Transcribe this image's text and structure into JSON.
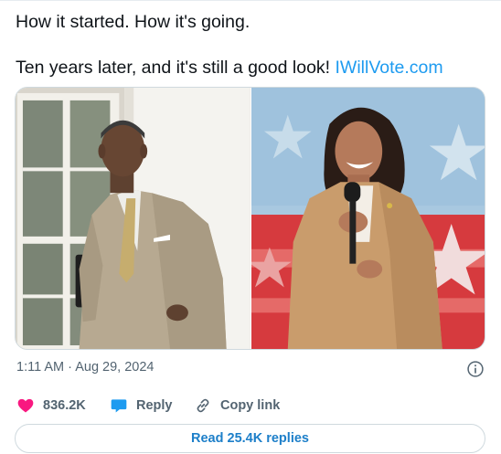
{
  "tweet": {
    "line1": "How it started. How it's going.",
    "line2": "Ten years later, and it's still a good look!",
    "link_text": "IWillVote.com",
    "timestamp": "1:11 AM · Aug 29, 2024"
  },
  "media": {
    "left_photo": "man-in-tan-suit-photo",
    "right_photo": "woman-in-tan-suit-with-microphone-photo"
  },
  "actions": {
    "like_count": "836.2K",
    "reply_label": "Reply",
    "copy_link_label": "Copy link"
  },
  "replies_button": "Read 25.4K replies",
  "colors": {
    "like": "#f91880",
    "reply_icon": "#1d9bf0",
    "link": "#1d9bf0",
    "secondary_text": "#536471"
  }
}
